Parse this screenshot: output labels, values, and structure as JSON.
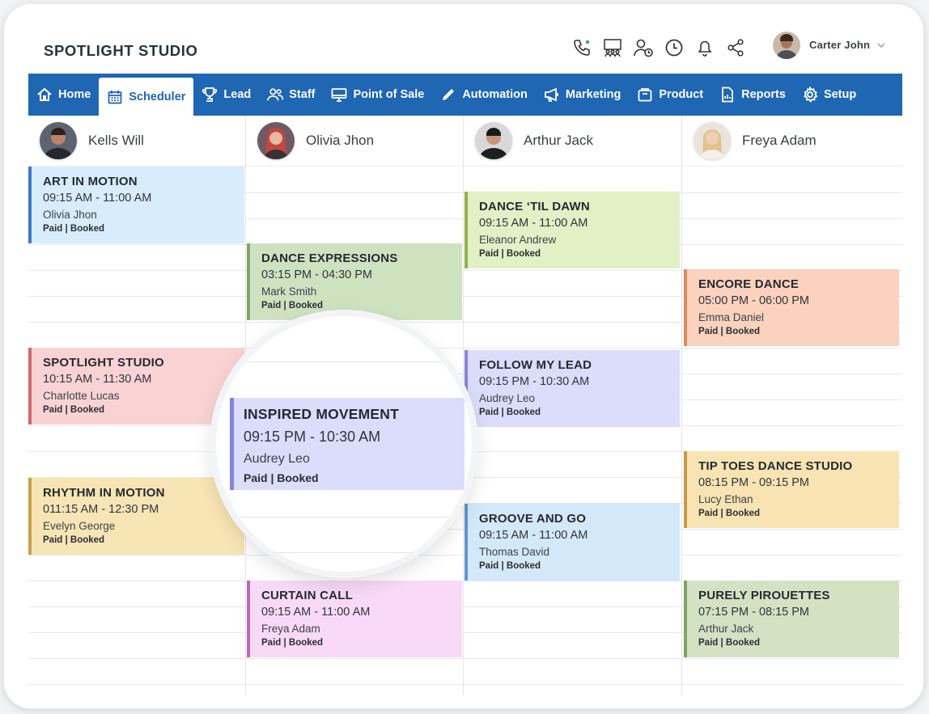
{
  "app": {
    "title": "SPOTLIGHT STUDIO"
  },
  "header_icons": [
    "phone-call-icon",
    "group-meeting-icon",
    "user-clock-icon",
    "clock-icon",
    "bell-icon",
    "share-icon"
  ],
  "user": {
    "name": "Carter John"
  },
  "nav": [
    {
      "label": "Home",
      "icon": "home-icon"
    },
    {
      "label": "Scheduler",
      "icon": "calendar-icon",
      "active": true
    },
    {
      "label": "Lead",
      "icon": "trophy-icon"
    },
    {
      "label": "Staff",
      "icon": "staff-icon"
    },
    {
      "label": "Point of Sale",
      "icon": "monitor-icon"
    },
    {
      "label": "Automation",
      "icon": "pencil-icon"
    },
    {
      "label": "Marketing",
      "icon": "megaphone-icon"
    },
    {
      "label": "Product",
      "icon": "box-icon"
    },
    {
      "label": "Reports",
      "icon": "report-icon"
    },
    {
      "label": "Setup",
      "icon": "gear-icon"
    }
  ],
  "staff": [
    {
      "name": "Kells Will"
    },
    {
      "name": "Olivia Jhon"
    },
    {
      "name": "Arthur Jack"
    },
    {
      "name": "Freya Adam"
    }
  ],
  "events": [
    {
      "title": "ART IN MOTION",
      "time": "09:15 AM - 11:00 AM",
      "person": "Olivia Jhon",
      "status": "Paid | Booked",
      "bg": "#d8ecfc",
      "accent": "#3e79c9"
    },
    {
      "title": "SPOTLIGHT STUDIO",
      "time": "10:15 AM - 11:30 AM",
      "person": "Charlotte Lucas",
      "status": "Paid | Booked",
      "bg": "#f9d3d3",
      "accent": "#d06a6a"
    },
    {
      "title": "RHYTHM IN MOTION",
      "time": "011:15 AM - 12:30 PM",
      "person": "Evelyn George",
      "status": "Paid | Booked",
      "bg": "#f8e5b5",
      "accent": "#c7a14c"
    },
    {
      "title": "DANCE EXPRESSIONS",
      "time": "03:15 PM - 04:30 PM",
      "person": "Mark Smith",
      "status": "Paid | Booked",
      "bg": "#cfe2c0",
      "accent": "#7fa366"
    },
    {
      "title": "CURTAIN CALL",
      "time": "09:15 AM - 11:00 AM",
      "person": "Freya Adam",
      "status": "Paid | Booked",
      "bg": "#f8daf6",
      "accent": "#b86ab3"
    },
    {
      "title": "DANCE ‘TIL DAWN",
      "time": "09:15 AM - 11:00 AM",
      "person": "Eleanor Andrew",
      "status": "Paid | Booked",
      "bg": "#e3f0c6",
      "accent": "#92b04d"
    },
    {
      "title": "FOLLOW MY LEAD",
      "time": "09:15 PM - 10:30 AM",
      "person": "Audrey Leo",
      "status": "Paid | Booked",
      "bg": "#dcdcfb",
      "accent": "#8a84d8"
    },
    {
      "title": "GROOVE AND GO",
      "time": "09:15 AM - 11:00 AM",
      "person": "Thomas David",
      "status": "Paid | Booked",
      "bg": "#d3e8f8",
      "accent": "#5d98cc"
    },
    {
      "title": "ENCORE DANCE",
      "time": "05:00 PM - 06:00 PM",
      "person": "Emma Daniel",
      "status": "Paid | Booked",
      "bg": "#fbd2bd",
      "accent": "#dd8a5e"
    },
    {
      "title": "TIP TOES DANCE STUDIO",
      "time": "08:15 PM - 09:15 PM",
      "person": "Lucy Ethan",
      "status": "Paid | Booked",
      "bg": "#f8e4b3",
      "accent": "#c49b48"
    },
    {
      "title": "PURELY PIROUETTES",
      "time": "07:15 PM - 08:15 PM",
      "person": "Arthur Jack",
      "status": "Paid | Booked",
      "bg": "#d2e2c2",
      "accent": "#7fa366"
    }
  ],
  "magnified_event": {
    "title": "INSPIRED MOVEMENT",
    "time": "09:15 PM - 10:30 AM",
    "person": "Audrey Leo",
    "status": "Paid | Booked"
  }
}
